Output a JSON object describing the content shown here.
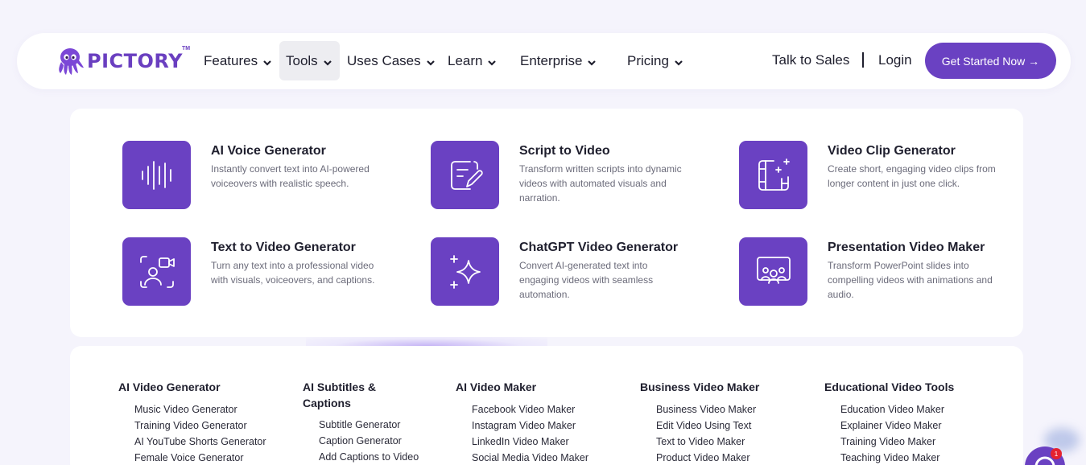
{
  "brand": {
    "name": "PICTORY",
    "tm": "TM",
    "color": "#6a3fc0"
  },
  "nav": {
    "items": [
      {
        "label": "Features",
        "active": false
      },
      {
        "label": "Tools",
        "active": true
      },
      {
        "label": "Uses Cases",
        "active": false
      },
      {
        "label": "Learn",
        "active": false
      },
      {
        "label": "Enterprise",
        "active": false
      },
      {
        "label": "Pricing",
        "active": false
      }
    ],
    "talk_to_sales": "Talk to Sales",
    "login": "Login",
    "cta": "Get Started Now →"
  },
  "tools": [
    {
      "title": "AI Voice Generator",
      "desc": "Instantly convert text into AI-powered voiceovers with realistic speech.",
      "icon": "waveform-icon"
    },
    {
      "title": "Script to Video",
      "desc": "Transform written scripts into dynamic videos with automated visuals and narration.",
      "icon": "script-edit-icon"
    },
    {
      "title": "Video Clip Generator",
      "desc": "Create short, engaging video clips from longer content in just one click.",
      "icon": "film-sparkle-icon"
    },
    {
      "title": "Text to Video Generator",
      "desc": "Turn any text into a professional video with visuals, voiceovers, and captions.",
      "icon": "user-camera-icon"
    },
    {
      "title": "ChatGPT Video Generator",
      "desc": "Convert AI-generated text into engaging videos with seamless automation.",
      "icon": "sparkles-icon"
    },
    {
      "title": "Presentation Video Maker",
      "desc": "Transform PowerPoint slides into compelling videos with animations and audio.",
      "icon": "presentation-face-icon"
    }
  ],
  "columns": [
    {
      "title": "AI Video Generator",
      "items": [
        "Music Video Generator",
        "Training Video Generator",
        "AI YouTube Shorts Generator",
        "Female Voice Generator"
      ]
    },
    {
      "title": "AI Subtitles & Captions",
      "items": [
        "Subtitle Generator",
        "Caption Generator",
        "Add Captions to Video"
      ]
    },
    {
      "title": "AI Video Maker",
      "items": [
        "Facebook Video Maker",
        "Instagram Video Maker",
        "LinkedIn Video Maker",
        "Social Media Video Maker"
      ]
    },
    {
      "title": "Business Video Maker",
      "items": [
        "Business Video Maker",
        "Edit Video Using Text",
        "Text to Video Maker",
        "Product Video Maker"
      ]
    },
    {
      "title": "Educational Video Tools",
      "items": [
        "Education Video Maker",
        "Explainer Video Maker",
        "Training Video Maker",
        "Teaching Video Maker"
      ]
    }
  ],
  "chat": {
    "badge": "1"
  },
  "colors": {
    "accent": "#6a41c2",
    "background": "#f5f4fc"
  }
}
